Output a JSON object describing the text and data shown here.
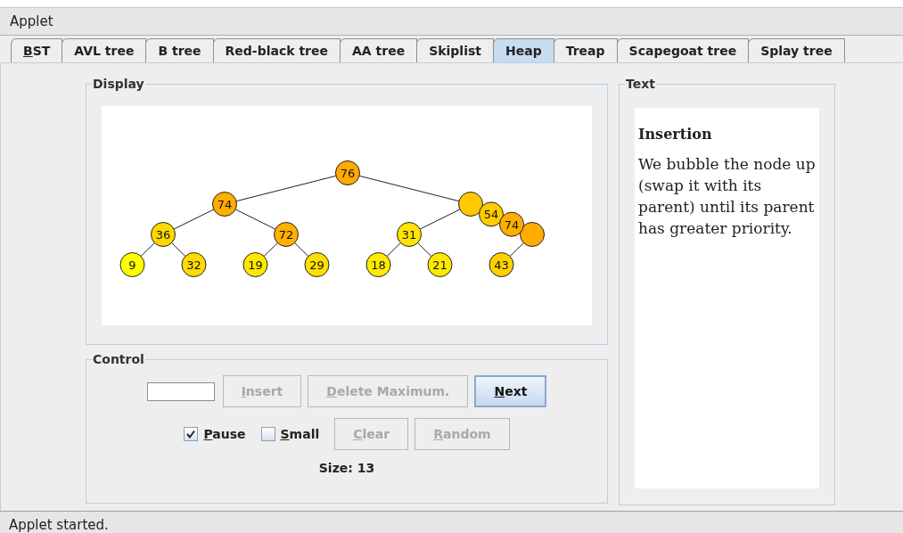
{
  "window": {
    "title": "Applet"
  },
  "tabs": [
    {
      "label": "BST",
      "selected": false,
      "mnemonic": true
    },
    {
      "label": "AVL tree",
      "selected": false,
      "mnemonic": false
    },
    {
      "label": "B tree",
      "selected": false,
      "mnemonic": false
    },
    {
      "label": "Red-black tree",
      "selected": false,
      "mnemonic": false
    },
    {
      "label": "AA tree",
      "selected": false,
      "mnemonic": false
    },
    {
      "label": "Skiplist",
      "selected": false,
      "mnemonic": false
    },
    {
      "label": "Heap",
      "selected": true,
      "mnemonic": false
    },
    {
      "label": "Treap",
      "selected": false,
      "mnemonic": false
    },
    {
      "label": "Scapegoat tree",
      "selected": false,
      "mnemonic": false
    },
    {
      "label": "Splay tree",
      "selected": false,
      "mnemonic": false
    }
  ],
  "display": {
    "title": "Display",
    "tree": {
      "label": "76",
      "color": "#ffaa00",
      "children": [
        {
          "label": "74",
          "color": "#ffae00",
          "children": [
            {
              "label": "36",
              "color": "#ffd800",
              "children": [
                {
                  "label": "9",
                  "color": "#ffff00"
                },
                {
                  "label": "32",
                  "color": "#ffdc00"
                }
              ]
            },
            {
              "label": "72",
              "color": "#ffb000",
              "children": [
                {
                  "label": "19",
                  "color": "#ffe800"
                },
                {
                  "label": "29",
                  "color": "#ffdf00"
                }
              ]
            }
          ]
        },
        {
          "color": "#ffc800",
          "children": [
            {
              "label": "31",
              "color": "#ffe400",
              "children": [
                {
                  "label": "18",
                  "color": "#ffec00"
                },
                {
                  "label": "21",
                  "color": "#ffe800"
                }
              ]
            },
            {
              "color": "#ffac00",
              "children": [
                {
                  "label": "43",
                  "color": "#ffd000"
                }
              ]
            }
          ]
        }
      ]
    },
    "moving_nodes": [
      {
        "label": "54",
        "color": "#ffcc00"
      },
      {
        "label": "74",
        "color": "#ffae00"
      }
    ]
  },
  "control": {
    "title": "Control",
    "buttons": [
      {
        "label": "Insert",
        "disabled": true,
        "focused": false
      },
      {
        "label": "Delete Maximum.",
        "disabled": true,
        "focused": false
      },
      {
        "label": "Next",
        "disabled": false,
        "focused": true
      }
    ],
    "checkboxes": [
      {
        "label": "Pause",
        "checked": true
      },
      {
        "label": "Small",
        "checked": false
      }
    ],
    "buttons_2": [
      {
        "label": "Clear",
        "disabled": true,
        "focused": false
      },
      {
        "label": "Random",
        "disabled": true,
        "focused": false
      }
    ],
    "size": "Size: 13"
  },
  "text_panel": {
    "title": "Text",
    "heading": "Insertion",
    "body": "We bubble the node up (swap it with its parent) until its parent has greater priority."
  },
  "status_bar": "Applet started."
}
